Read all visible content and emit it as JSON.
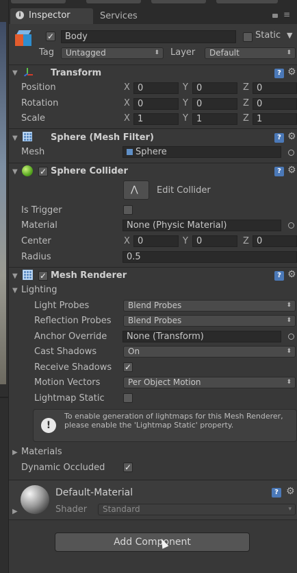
{
  "tabs": {
    "inspector": "Inspector",
    "services": "Services"
  },
  "object": {
    "name": "Body",
    "static_label": "Static",
    "tag_label": "Tag",
    "tag_value": "Untagged",
    "layer_label": "Layer",
    "layer_value": "Default"
  },
  "transform": {
    "title": "Transform",
    "rows": [
      {
        "label": "Position",
        "x": "0",
        "y": "0",
        "z": "0"
      },
      {
        "label": "Rotation",
        "x": "0",
        "y": "0",
        "z": "0"
      },
      {
        "label": "Scale",
        "x": "1",
        "y": "1",
        "z": "1"
      }
    ]
  },
  "axes": {
    "x": "X",
    "y": "Y",
    "z": "Z"
  },
  "mesh_filter": {
    "title": "Sphere (Mesh Filter)",
    "mesh_label": "Mesh",
    "mesh_value": "Sphere"
  },
  "sphere_collider": {
    "title": "Sphere Collider",
    "edit_collider": "Edit Collider",
    "is_trigger": "Is Trigger",
    "material_label": "Material",
    "material_value": "None (Physic Material)",
    "center_label": "Center",
    "center_x": "0",
    "center_y": "0",
    "center_z": "0",
    "radius_label": "Radius",
    "radius_value": "0.5"
  },
  "mesh_renderer": {
    "title": "Mesh Renderer",
    "lighting": "Lighting",
    "light_probes_label": "Light Probes",
    "light_probes_value": "Blend Probes",
    "reflection_probes_label": "Reflection Probes",
    "reflection_probes_value": "Blend Probes",
    "anchor_override_label": "Anchor Override",
    "anchor_override_value": "None (Transform)",
    "cast_shadows_label": "Cast Shadows",
    "cast_shadows_value": "On",
    "receive_shadows_label": "Receive Shadows",
    "motion_vectors_label": "Motion Vectors",
    "motion_vectors_value": "Per Object Motion",
    "lightmap_static_label": "Lightmap Static",
    "info": "To enable generation of lightmaps for this Mesh Renderer, please enable the 'Lightmap Static' property.",
    "materials": "Materials",
    "dynamic_occluded": "Dynamic Occluded"
  },
  "material": {
    "name": "Default-Material",
    "shader_label": "Shader",
    "shader_value": "Standard"
  },
  "add_component": "Add Component"
}
